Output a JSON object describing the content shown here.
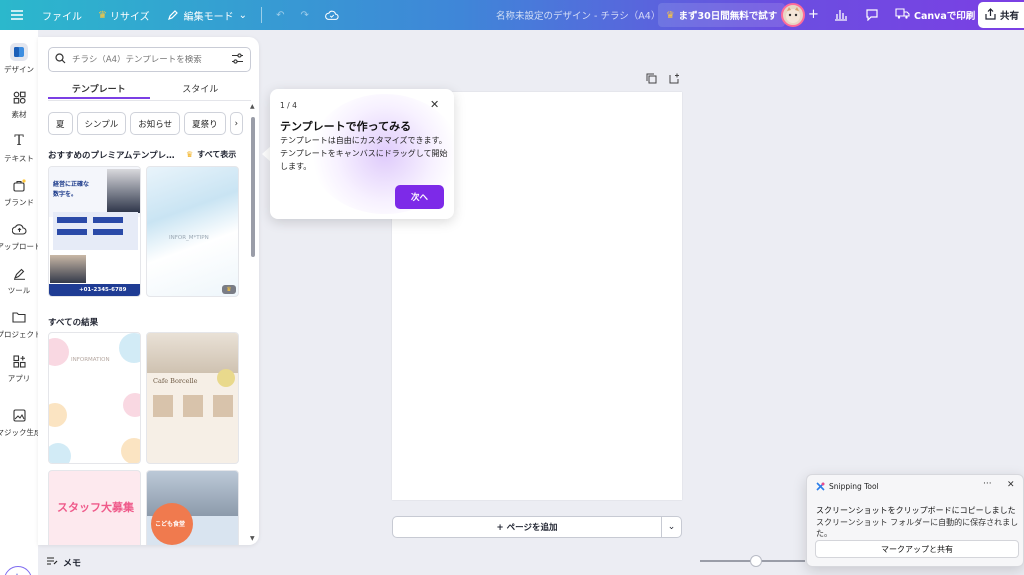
{
  "topbar": {
    "file": "ファイル",
    "resize": "リサイズ",
    "edit_mode": "編集モード",
    "doc_title": "名称未設定のデザイン - チラシ（A4）",
    "trial": "まず30日間無料で試す",
    "print": "Canvaで印刷",
    "share": "共有"
  },
  "rail": {
    "design": "デザイン",
    "elements": "素材",
    "text": "テキスト",
    "brand": "ブランド",
    "upload": "アップロード",
    "tools": "ツール",
    "projects": "プロジェクト",
    "apps": "アプリ",
    "magic": "マジック生成"
  },
  "panel": {
    "search_placeholder": "チラシ（A4）テンプレートを検索",
    "tab_templates": "テンプレート",
    "tab_styles": "スタイル",
    "chips": [
      "夏",
      "シンプル",
      "お知らせ",
      "夏祭り"
    ],
    "premium_heading": "おすすめのプレミアムテンプレ…",
    "see_all": "すべて表示",
    "all_results": "すべての結果",
    "t1_lines": [
      "経営に正確な",
      "数字を。"
    ],
    "t1_phone": "+01-2345-6789",
    "t2_title": "INFOR_M*TIPN",
    "t3_title": "INFORMATION",
    "t4_title": "Cafe Borcelle",
    "t5_title": "スタッフ大募集",
    "t6_title": "こども食堂"
  },
  "tooltip": {
    "step": "1 / 4",
    "title": "テンプレートで作ってみる",
    "body": "テンプレートは自由にカスタマイズできます。テンプレートをキャンバスにドラッグして開始します。",
    "next": "次へ"
  },
  "canvas": {
    "add_page": "+ ページを追加",
    "memo": "メモ"
  },
  "toast": {
    "app": "Snipping Tool",
    "line1": "スクリーンショットをクリップボードにコピーしました",
    "line2": "スクリーンショット フォルダーに自動的に保存されました。",
    "button": "マークアップと共有"
  },
  "colors": {
    "accent": "#7d2ae8",
    "topbar_start": "#2bb8cc",
    "topbar_end": "#7b3fe4"
  }
}
